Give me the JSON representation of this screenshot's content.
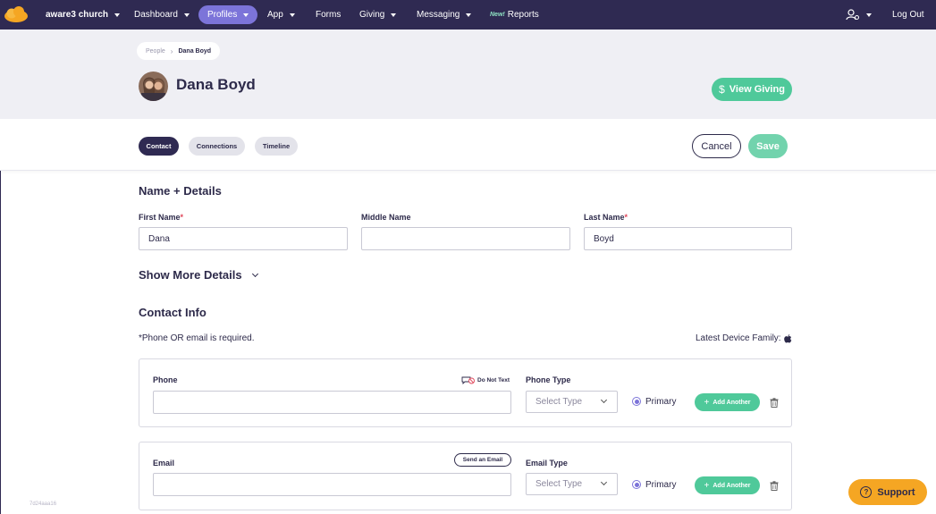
{
  "nav": {
    "org": "aware3 church",
    "dashboard": "Dashboard",
    "profiles": "Profiles",
    "app": "App",
    "forms": "Forms",
    "giving": "Giving",
    "messaging": "Messaging",
    "new_tag": "New!",
    "reports": "Reports",
    "logout": "Log Out"
  },
  "breadcrumb": [
    "People",
    "Dana Boyd"
  ],
  "profile": {
    "name": "Dana Boyd",
    "view_giving": "View Giving"
  },
  "tabs": [
    {
      "label": "Contact",
      "active": true
    },
    {
      "label": "Connections",
      "active": false
    },
    {
      "label": "Timeline",
      "active": false
    }
  ],
  "actions": {
    "cancel": "Cancel",
    "save": "Save"
  },
  "name_details": {
    "title": "Name + Details",
    "first_label": "First Name",
    "first_value": "Dana",
    "middle_label": "Middle Name",
    "middle_value": "",
    "last_label": "Last Name",
    "last_value": "Boyd",
    "required_mark": "*",
    "show_more": "Show More Details"
  },
  "contact_info": {
    "title": "Contact Info",
    "required_note": "*Phone OR email is required.",
    "device_family": "Latest Device Family:",
    "device_icon": "apple-icon",
    "phone": {
      "label": "Phone",
      "value": "",
      "do_not_text": "Do Not Text",
      "type_label": "Phone Type",
      "type_placeholder": "Select Type",
      "primary": "Primary",
      "add_another": "Add Another"
    },
    "email": {
      "label": "Email",
      "value": "",
      "send_email": "Send an Email",
      "type_label": "Email Type",
      "type_placeholder": "Select Type",
      "primary": "Primary",
      "add_another": "Add Another"
    }
  },
  "support": "Support",
  "version": "7d24aaa16",
  "colors": {
    "navbar": "#2f2a52",
    "accent_purple": "#7c74d9",
    "green": "#4fc99a",
    "support_orange": "#f5a623",
    "required_red": "#e0475b"
  }
}
